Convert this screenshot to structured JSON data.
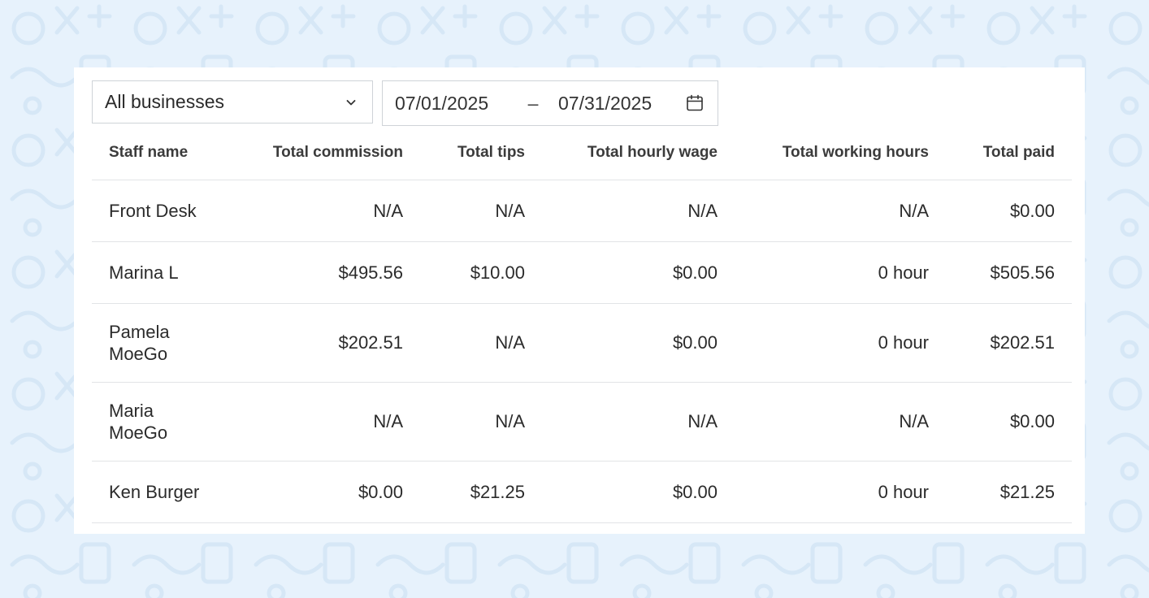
{
  "filters": {
    "business_select": {
      "value": "All businesses",
      "icon": "chevron-down-icon"
    },
    "date_range": {
      "start": "07/01/2025",
      "separator": "–",
      "end": "07/31/2025",
      "icon": "calendar-icon"
    }
  },
  "table": {
    "columns": [
      "Staff name",
      "Total commission",
      "Total tips",
      "Total hourly wage",
      "Total working hours",
      "Total paid"
    ],
    "rows": [
      [
        "Front Desk",
        "N/A",
        "N/A",
        "N/A",
        "N/A",
        "$0.00"
      ],
      [
        "Marina L",
        "$495.56",
        "$10.00",
        "$0.00",
        "0 hour",
        "$505.56"
      ],
      [
        "Pamela MoeGo",
        "$202.51",
        "N/A",
        "$0.00",
        "0 hour",
        "$202.51"
      ],
      [
        "Maria MoeGo",
        "N/A",
        "N/A",
        "N/A",
        "N/A",
        "$0.00"
      ],
      [
        "Ken Burger",
        "$0.00",
        "$21.25",
        "$0.00",
        "0 hour",
        "$21.25"
      ]
    ]
  },
  "colors": {
    "page_background": "#e7f2fc",
    "card_background": "#ffffff",
    "border": "#cfd3d8",
    "row_divider": "#e2e4e6"
  }
}
